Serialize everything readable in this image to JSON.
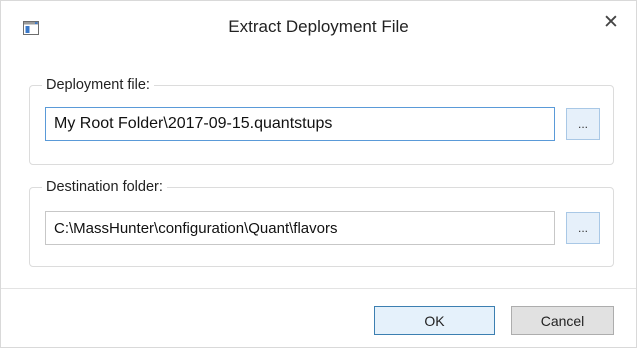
{
  "window": {
    "title": "Extract Deployment File",
    "close_label": "✕"
  },
  "deployment_file": {
    "legend": "Deployment file:",
    "value": "My Root Folder\\2017-09-15.quantstups",
    "browse_label": "..."
  },
  "destination_folder": {
    "legend": "Destination folder:",
    "value": "C:\\MassHunter\\configuration\\Quant\\flavors",
    "browse_label": "..."
  },
  "buttons": {
    "ok_label": "OK",
    "cancel_label": "Cancel"
  },
  "colors": {
    "accent": "#3c7fb1",
    "focused_border": "#5a9ad8",
    "browse_button_bg": "#e6f0fa"
  },
  "icons": {
    "app": "window-icon",
    "close": "close-icon"
  }
}
